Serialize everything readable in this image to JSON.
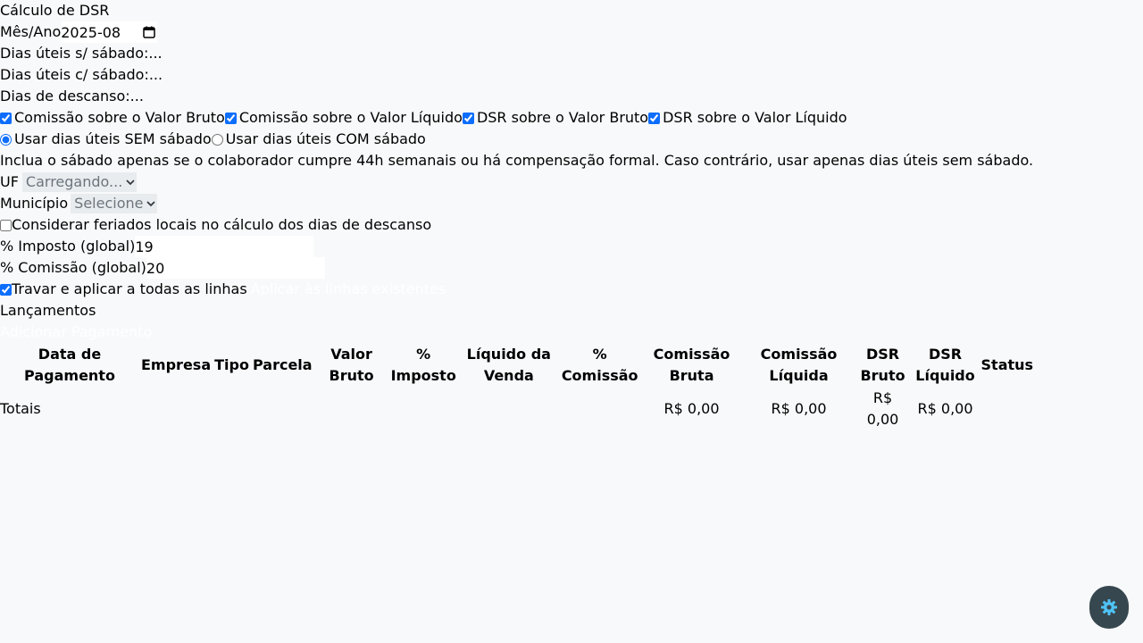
{
  "page_title": "Cálculo de DSR",
  "month": {
    "label": "Mês/Ano",
    "value": "2025-08"
  },
  "days": {
    "without_saturday_label": "Dias úteis s/ sábado:",
    "without_saturday_value": "...",
    "with_saturday_label": "Dias úteis c/ sábado:",
    "with_saturday_value": "...",
    "rest_label": "Dias de descanso:",
    "rest_value": "..."
  },
  "options": [
    {
      "label": "Comissão sobre o Valor Bruto",
      "checked": true
    },
    {
      "label": "Comissão sobre o Valor Líquido",
      "checked": true
    },
    {
      "label": "DSR sobre o Valor Bruto",
      "checked": true
    },
    {
      "label": "DSR sobre o Valor Líquido",
      "checked": true
    }
  ],
  "day_mode": [
    {
      "label": "Usar dias úteis SEM sábado",
      "checked": true
    },
    {
      "label": "Usar dias úteis COM sábado",
      "checked": false
    }
  ],
  "saturday_note": "Inclua o sábado apenas se o colaborador cumpre 44h semanais ou há compensação formal. Caso contrário, usar apenas dias úteis sem sábado.",
  "uf": {
    "label": "UF",
    "selected": "Carregando..."
  },
  "municipio": {
    "label": "Município",
    "selected": "Selecione"
  },
  "local_holidays": {
    "label": "Considerar feriados locais no cálculo dos dias de descanso",
    "checked": false
  },
  "tax": {
    "label": "% Imposto (global)",
    "value": "19"
  },
  "commission": {
    "label": "% Comissão (global)",
    "value": "20"
  },
  "lock_apply": {
    "label": "Travar e aplicar a todas as linhas",
    "checked": true,
    "apply_existing_label": "Aplicar às linhas existentes"
  },
  "entries": {
    "title": "Lançamentos",
    "add_payment_label": "Adicionar Pagamento"
  },
  "table": {
    "headers": [
      "Data de Pagamento",
      "Empresa",
      "Tipo",
      "Parcela",
      "Valor Bruto",
      "% Imposto",
      "Líquido da Venda",
      "% Comissão",
      "Comissão Bruta",
      "Comissão Líquida",
      "DSR Bruto",
      "DSR Líquido",
      "Status"
    ],
    "totals": {
      "label": "Totais",
      "comissao_bruta": "R$ 0,00",
      "comissao_liquida": "R$ 0,00",
      "dsr_bruto": "R$ 0,00",
      "dsr_liquido": "R$ 0,00"
    }
  },
  "icons": {
    "calendar": "calendar-icon",
    "chevron": "chevron-down-icon",
    "settings": "gear-icon"
  },
  "colors": {
    "background": "#f8f9fa",
    "accent": "#0d6efd",
    "select_bg": "#e9ecef",
    "fab_bg": "#37474f",
    "fab_icon": "#4fc3f7"
  }
}
